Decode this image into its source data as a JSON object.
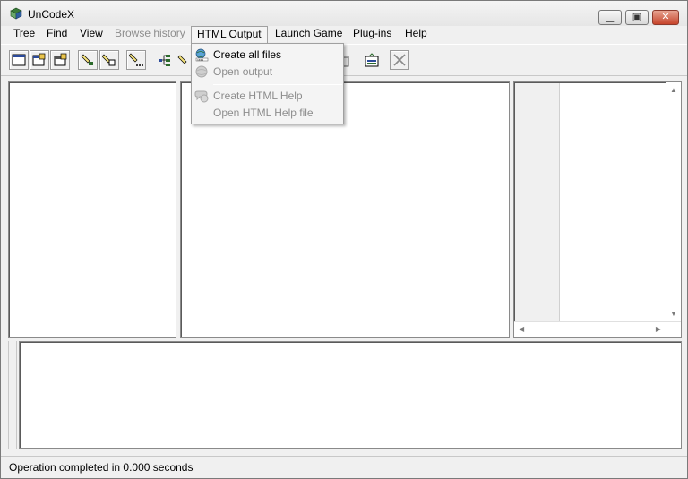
{
  "window": {
    "title": "UnCodeX"
  },
  "caption_buttons": {
    "minimize": "minimize",
    "maximize": "maximize",
    "close": "close"
  },
  "menubar": {
    "items": [
      {
        "label": "Tree",
        "enabled": true
      },
      {
        "label": "Find",
        "enabled": true
      },
      {
        "label": "View",
        "enabled": true
      },
      {
        "label": "Browse history",
        "enabled": false
      },
      {
        "label": "HTML Output",
        "enabled": true,
        "open": true
      },
      {
        "label": "Launch Game",
        "enabled": true
      },
      {
        "label": "Plug-ins",
        "enabled": true
      },
      {
        "label": "Help",
        "enabled": true
      }
    ]
  },
  "dropdown": {
    "items": [
      {
        "label": "Create all files",
        "enabled": true,
        "icon": "create-files-icon"
      },
      {
        "label": "Open output",
        "enabled": false,
        "icon": "open-output-icon"
      },
      {
        "label": "Create HTML Help",
        "enabled": false,
        "icon": "html-help-icon"
      },
      {
        "label": "Open HTML Help file",
        "enabled": false,
        "icon": ""
      }
    ]
  },
  "toolbar": {
    "buttons": [
      "new-tree-icon",
      "properties-icon",
      "package-properties-icon",
      "find-icon",
      "find-next-icon",
      "find-more-icon",
      "tree-icon",
      "find-class-icon",
      "delete-icon",
      "save-icon",
      "cancel-icon"
    ]
  },
  "statusbar": {
    "text": "Operation completed in 0.000 seconds"
  },
  "colors": {
    "accent_close": "#c7442b",
    "pane_bg": "#ffffff",
    "chrome_bg": "#f0f0f0"
  }
}
